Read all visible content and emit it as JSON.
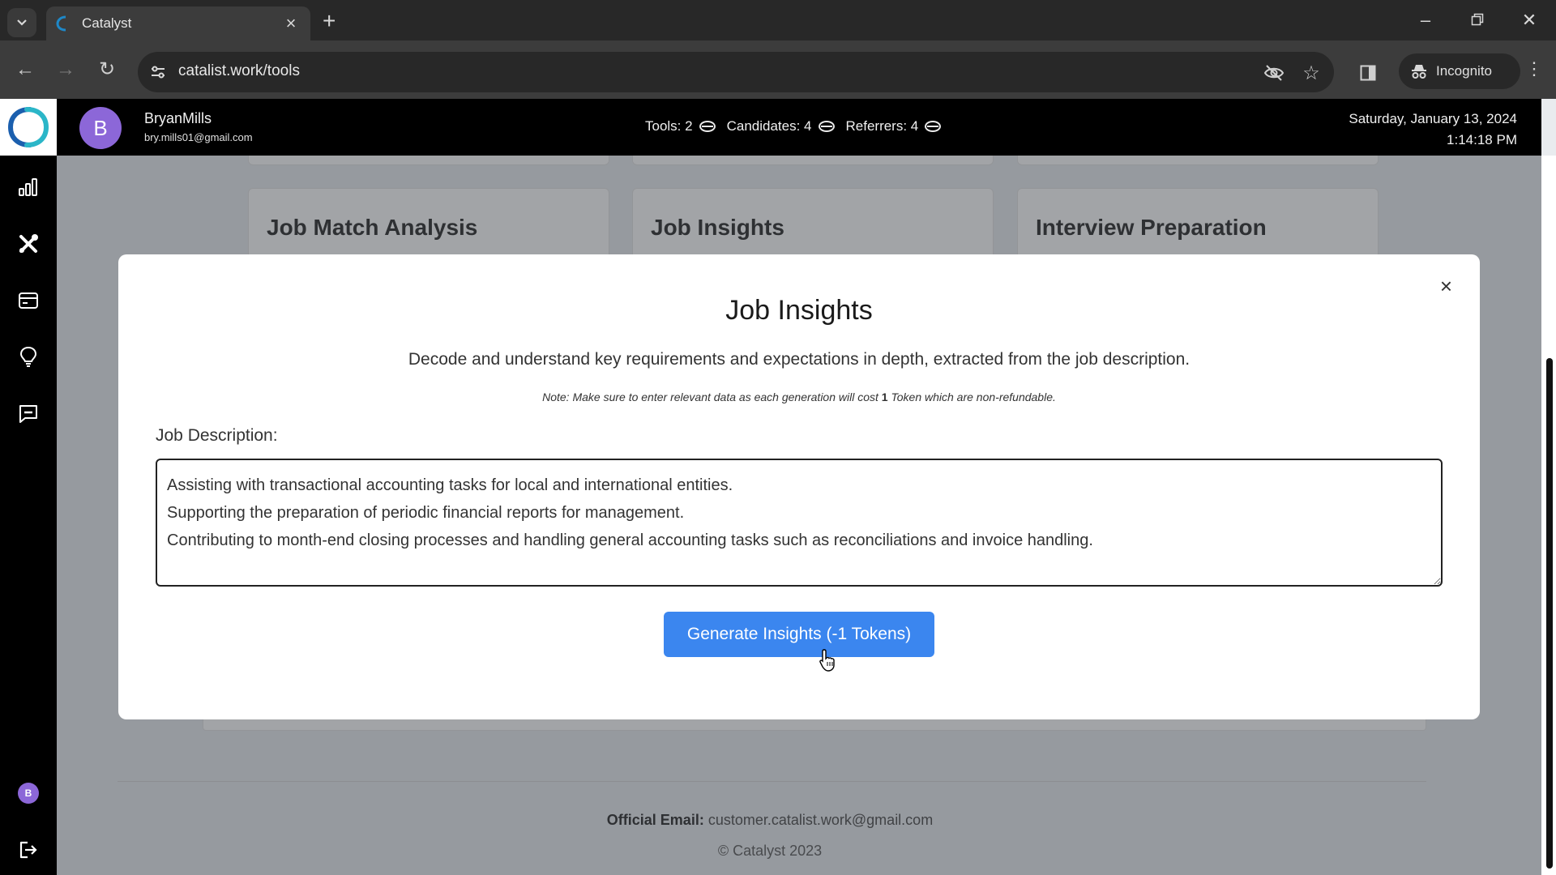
{
  "browser": {
    "tab_title": "Catalyst",
    "url": "catalist.work/tools",
    "incognito_label": "Incognito",
    "icons": {
      "tab_list": "chevron-down-icon",
      "tab_close": "close-icon",
      "new_tab": "plus-icon",
      "minimize": "minimize-icon",
      "restore": "restore-icon",
      "close_window": "close-icon",
      "back": "arrow-left-icon",
      "forward": "arrow-right-icon",
      "reload": "reload-icon",
      "site_info": "tune-icon",
      "tracking": "eye-off-icon",
      "bookmark": "star-icon",
      "side_panel": "side-panel-icon",
      "incognito": "incognito-icon",
      "menu": "kebab-icon"
    }
  },
  "header": {
    "avatar_letter": "B",
    "user_name": "BryanMills",
    "user_email": "bry.mills01@gmail.com",
    "stats": [
      {
        "label": "Tools: 2",
        "icon": "coin-icon"
      },
      {
        "label": "Candidates: 4",
        "icon": "coin-icon"
      },
      {
        "label": "Referrers: 4",
        "icon": "coin-icon"
      }
    ],
    "date": "Saturday, January 13, 2024",
    "time": "1:14:18 PM"
  },
  "sidebar": {
    "items": [
      {
        "name": "analytics",
        "icon": "bar-chart-icon"
      },
      {
        "name": "tools",
        "icon": "tools-icon"
      },
      {
        "name": "billing",
        "icon": "credit-card-icon"
      },
      {
        "name": "ideas",
        "icon": "lightbulb-icon"
      },
      {
        "name": "messages",
        "icon": "message-icon"
      }
    ],
    "avatar_letter": "B",
    "logout_icon": "logout-icon"
  },
  "cards": [
    {
      "title": "Job Match Analysis"
    },
    {
      "title": "Job Insights"
    },
    {
      "title": "Interview Preparation"
    }
  ],
  "modal": {
    "title": "Job Insights",
    "description": "Decode and understand key requirements and expectations in depth, extracted from the job description.",
    "note_prefix": "Note: Make sure to enter relevant data as each generation will cost ",
    "note_cost": "1",
    "note_suffix": " Token which are non-refundable.",
    "job_description_label": "Job Description:",
    "job_description_value": "Assisting with transactional accounting tasks for local and international entities.\nSupporting the preparation of periodic financial reports for management.\nContributing to month-end closing processes and handling general accounting tasks such as reconciliations and invoice handling.",
    "generate_button": "Generate Insights (-1 Tokens)",
    "close_icon": "close-icon"
  },
  "footer": {
    "email_label": "Official Email:",
    "email_value": "customer.catalist.work@gmail.com",
    "copyright": "© Catalyst 2023"
  },
  "colors": {
    "accent": "#3b86ef",
    "avatar": "#8c67d8",
    "header_bg": "#000000"
  }
}
